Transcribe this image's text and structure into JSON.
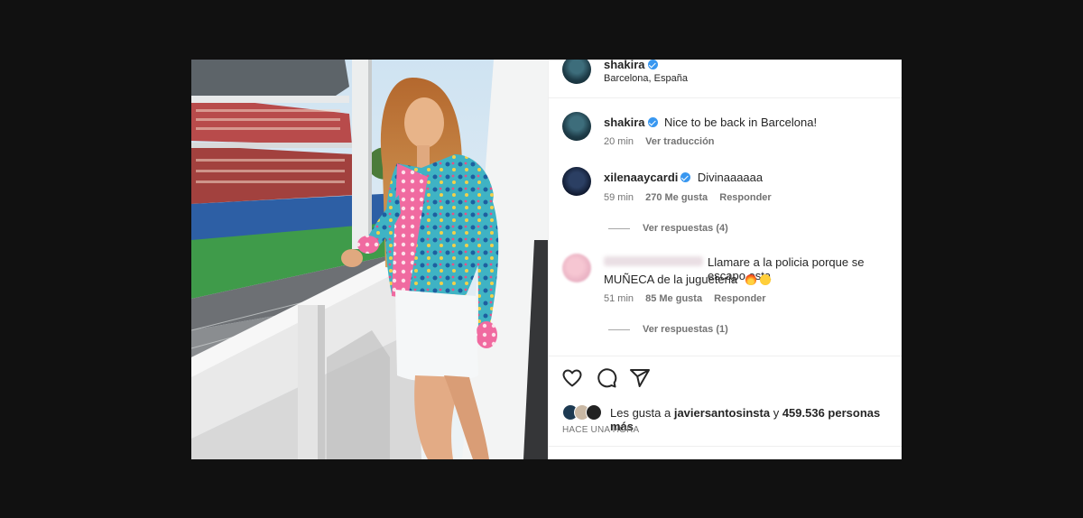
{
  "header": {
    "username": "shakira",
    "location": "Barcelona, España"
  },
  "caption": {
    "username": "shakira",
    "text": "Nice to be back in Barcelona!",
    "time": "20 min",
    "translate": "Ver traducción"
  },
  "comments": [
    {
      "username": "xilenaaycardi",
      "text": "Divinaaaaaa",
      "time": "59 min",
      "likes": "270 Me gusta",
      "reply": "Responder",
      "view_replies": "Ver respuestas (4)"
    },
    {
      "text_line1": "Llamare a la policia porque se escapo esta",
      "text_line2": "MUÑECA de la jugueteria",
      "time": "51 min",
      "likes": "85 Me gusta",
      "reply": "Responder",
      "view_replies": "Ver respuestas (1)"
    }
  ],
  "likes": {
    "prefix": "Les gusta a",
    "user": "javiersantosinsta",
    "connector": "y",
    "rest": "459.536 personas más"
  },
  "timestamp": "HACE UNA HORA",
  "icons": [
    "heart-icon",
    "comment-icon",
    "share-icon",
    "verified-badge-icon",
    "fire-emoji-icon",
    "heart-eyes-emoji-icon"
  ],
  "colors": {
    "verified": "#3897f0",
    "text": "#262626",
    "muted": "#737373",
    "backdrop": "#111111"
  }
}
